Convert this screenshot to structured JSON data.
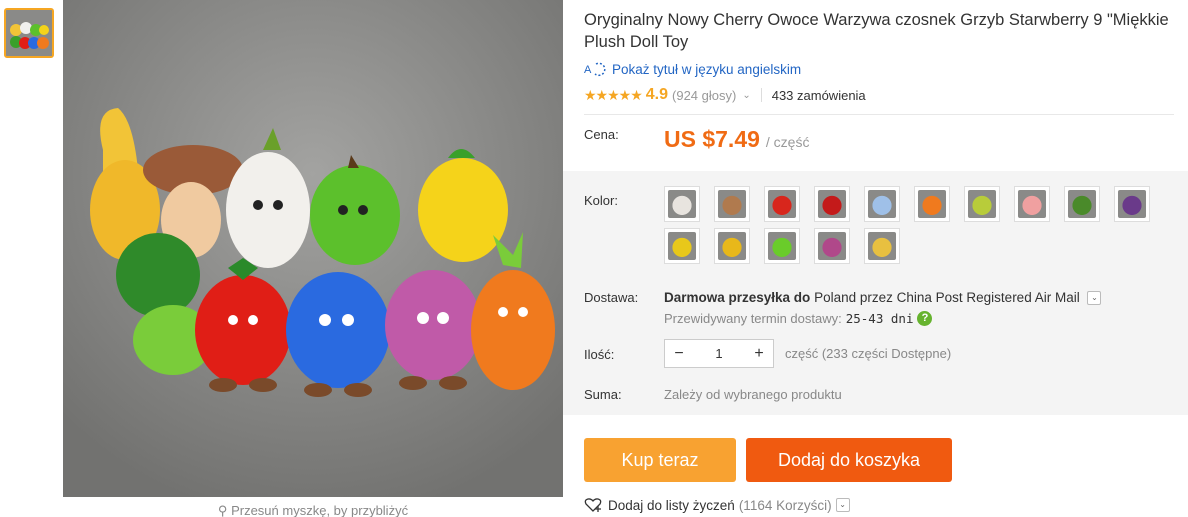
{
  "product": {
    "title": "Oryginalny Nowy Cherry Owoce Warzywa czosnek Grzyb Starwberry 9 \"Miękkie Plush Doll Toy",
    "translate_link": "Pokaż tytuł w języku angielskim",
    "stars": "★★★★★",
    "rating": "4.9",
    "votes": "(924 głosy)",
    "orders": "433 zamówienia"
  },
  "price": {
    "label": "Cena:",
    "value": "US $7.49",
    "unit": "/ część"
  },
  "color": {
    "label": "Kolor:",
    "swatches": [
      {
        "name": "garlic",
        "color": "#e8e4df"
      },
      {
        "name": "mushroom",
        "color": "#b07a4e"
      },
      {
        "name": "tomato",
        "color": "#d8261c"
      },
      {
        "name": "cherry",
        "color": "#c41a1a"
      },
      {
        "name": "blueberry",
        "color": "#9fc0e8"
      },
      {
        "name": "carrot",
        "color": "#f07a1e"
      },
      {
        "name": "pear",
        "color": "#b8cc3a"
      },
      {
        "name": "strawberry",
        "color": "#f0a0a0"
      },
      {
        "name": "cucumber",
        "color": "#4a8a2a"
      },
      {
        "name": "eggplant",
        "color": "#6a3a8a"
      },
      {
        "name": "lemon",
        "color": "#e8c81a"
      },
      {
        "name": "pepper",
        "color": "#e8b81a"
      },
      {
        "name": "apple",
        "color": "#6acc2a"
      },
      {
        "name": "onion",
        "color": "#b0488a"
      },
      {
        "name": "banana",
        "color": "#e8c040"
      }
    ]
  },
  "shipping": {
    "label": "Dostawa:",
    "prefix": "Darmowa przesyłka do",
    "detail": "Poland przez China Post Registered Air Mail",
    "estimate_label": "Przewidywany termin dostawy:",
    "estimate_days": "25-43 dni"
  },
  "quantity": {
    "label": "Ilość:",
    "value": "1",
    "stock": "część (233 części Dostępne)"
  },
  "total": {
    "label": "Suma:",
    "value": "Zależy od wybranego produktu"
  },
  "buttons": {
    "buy_now": "Kup teraz",
    "add_to_cart": "Dodaj do koszyka"
  },
  "wishlist": {
    "label": "Dodaj do listy życzeń",
    "count": "(1164 Korzyści)"
  },
  "image": {
    "zoom_hint": "Przesuń myszkę, by przybliżyć"
  }
}
